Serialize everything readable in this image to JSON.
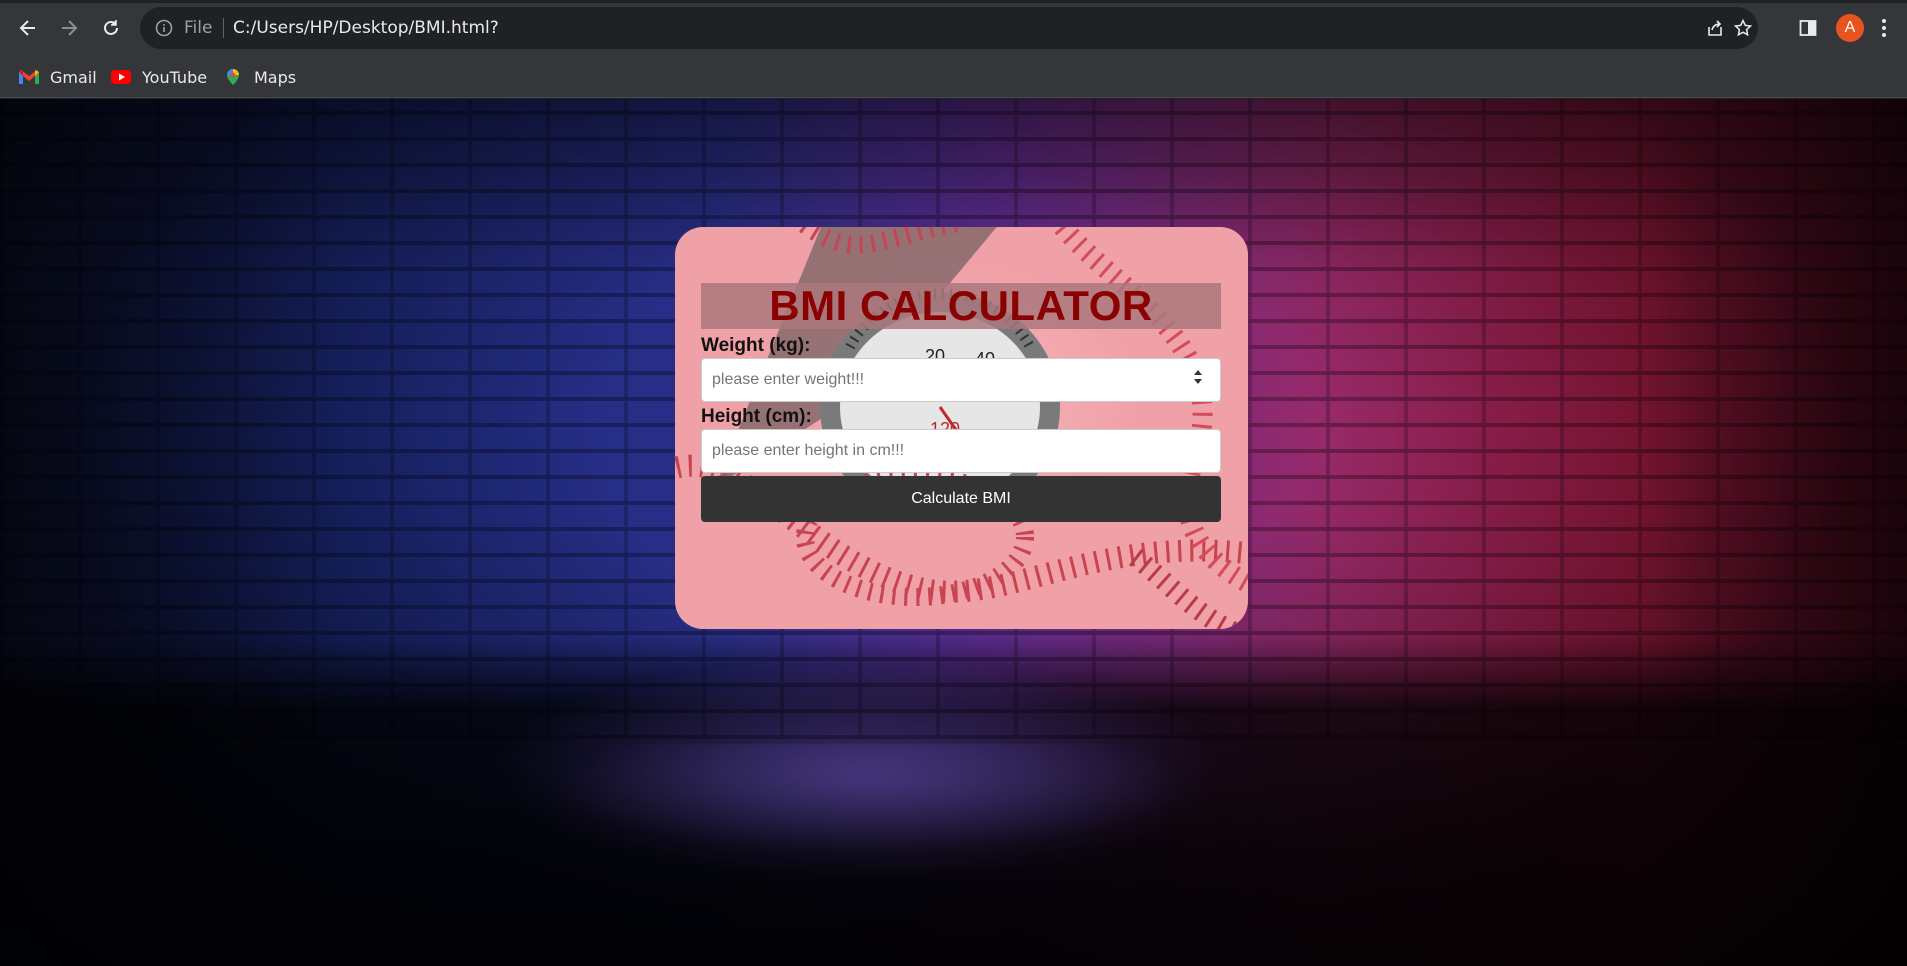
{
  "browser": {
    "scheme_label": "File",
    "url": "C:/Users/HP/Desktop/BMI.html?",
    "profile_initial": "A",
    "bookmarks": [
      {
        "label": "Gmail",
        "icon": "gmail-icon"
      },
      {
        "label": "YouTube",
        "icon": "youtube-icon"
      },
      {
        "label": "Maps",
        "icon": "maps-icon"
      }
    ]
  },
  "card": {
    "title": "BMI CALCULATOR",
    "weight_label": "Weight (kg):",
    "weight_placeholder": "please enter weight!!!",
    "height_label": "Height (cm):",
    "height_placeholder": "please enter height in cm!!!",
    "button_label": "Calculate BMI",
    "title_color": "#8b0000",
    "button_color": "#333333"
  },
  "colors": {
    "chrome_toolbar": "#35363a",
    "omnibox": "#202124",
    "avatar": "#e8541f"
  }
}
